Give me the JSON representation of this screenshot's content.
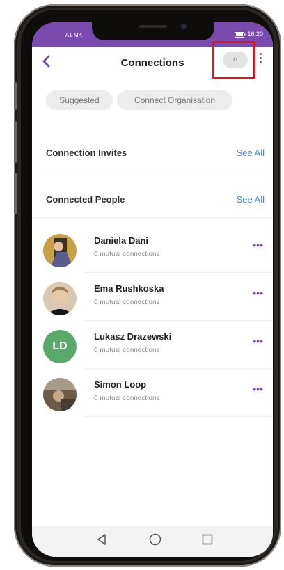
{
  "status_bar": {
    "carrier": "A1 MK",
    "time": "16:20"
  },
  "header": {
    "title": "Connections",
    "action_button_label": "∩"
  },
  "chips": [
    "Suggested",
    "Connect Organisation"
  ],
  "sections": {
    "invites": {
      "title": "Connection Invites",
      "see_all": "See All"
    },
    "connected": {
      "title": "Connected People",
      "see_all": "See All"
    }
  },
  "people": [
    {
      "name": "Daniela Dani",
      "subtitle": "0 mutual connections",
      "avatar": "photo"
    },
    {
      "name": "Ema Rushkoska",
      "subtitle": "0 mutual connections",
      "avatar": "photo"
    },
    {
      "name": "Lukasz Drazewski",
      "subtitle": "0 mutual connections",
      "avatar": "initials",
      "initials": "LD"
    },
    {
      "name": "Simon Loop",
      "subtitle": "0 mutual connections",
      "avatar": "photo"
    }
  ],
  "more_glyph": "•••",
  "colors": {
    "accent": "#7b4aae",
    "link": "#4a86d6",
    "highlight": "#e0141a",
    "initials_avatar": "#5aa86a"
  },
  "icons": {
    "back": "chevron-left-icon",
    "menu": "kebab-menu-icon",
    "nav_back": "triangle-back-icon",
    "nav_home": "circle-home-icon",
    "nav_recents": "square-recents-icon"
  }
}
